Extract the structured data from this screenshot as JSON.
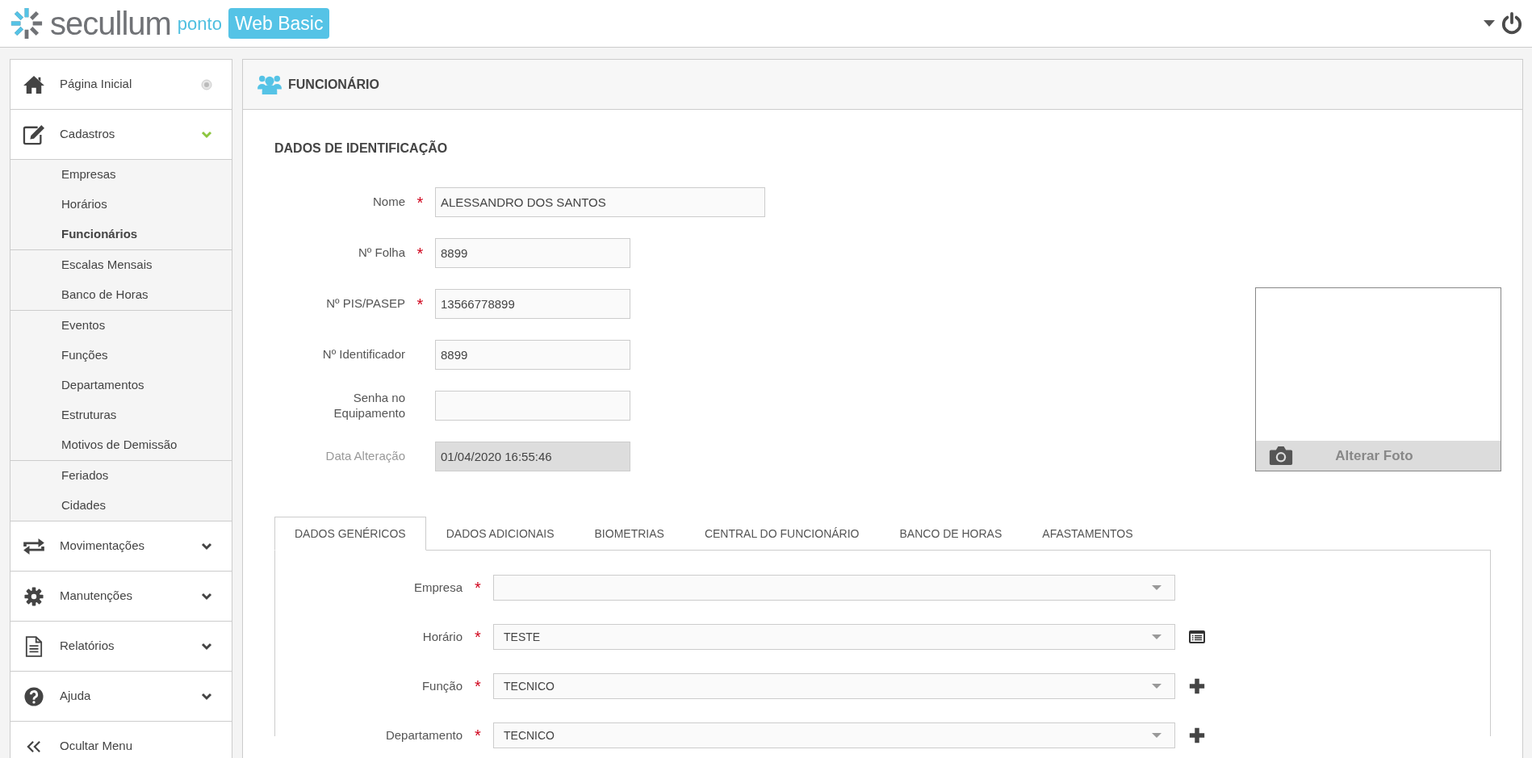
{
  "header": {
    "brand": "secullum",
    "product": "ponto",
    "edition": "Web Basic"
  },
  "sidebar": {
    "items": [
      {
        "kind": "link",
        "label": "Página Inicial"
      },
      {
        "kind": "group",
        "label": "Cadastros",
        "expanded": true,
        "groups": [
          {
            "items": [
              {
                "label": "Empresas",
                "selected": false
              },
              {
                "label": "Horários",
                "selected": false
              },
              {
                "label": "Funcionários",
                "selected": true
              }
            ]
          },
          {
            "items": [
              {
                "label": "Escalas Mensais",
                "selected": false
              },
              {
                "label": "Banco de Horas",
                "selected": false
              }
            ]
          },
          {
            "items": [
              {
                "label": "Eventos",
                "selected": false
              },
              {
                "label": "Funções",
                "selected": false
              },
              {
                "label": "Departamentos",
                "selected": false
              },
              {
                "label": "Estruturas",
                "selected": false
              },
              {
                "label": "Motivos de Demissão",
                "selected": false
              }
            ]
          },
          {
            "items": [
              {
                "label": "Feriados",
                "selected": false
              },
              {
                "label": "Cidades",
                "selected": false
              }
            ]
          }
        ]
      },
      {
        "kind": "group",
        "label": "Movimentações",
        "expanded": false
      },
      {
        "kind": "group",
        "label": "Manutenções",
        "expanded": false
      },
      {
        "kind": "group",
        "label": "Relatórios",
        "expanded": false
      },
      {
        "kind": "group",
        "label": "Ajuda",
        "expanded": false
      },
      {
        "kind": "toggle",
        "label": "Ocultar Menu"
      }
    ]
  },
  "page": {
    "title": "FUNCIONÁRIO"
  },
  "section": {
    "title": "DADOS DE IDENTIFICAÇÃO"
  },
  "fields": [
    {
      "label": "Nome",
      "required_mark": "*",
      "value": "ALESSANDRO DOS SANTOS",
      "disabled": false
    },
    {
      "label": "Nº Folha",
      "required_mark": "*",
      "value": "8899",
      "disabled": false
    },
    {
      "label": "Nº PIS/PASEP",
      "required_mark": "*",
      "value": "13566778899",
      "disabled": false
    },
    {
      "label": "Nº Identificador",
      "value": "8899",
      "disabled": false
    },
    {
      "label": "Senha no Equipamento",
      "disabled": false
    },
    {
      "label": "Data Alteração",
      "value": "01/04/2020 16:55:46",
      "disabled": true
    }
  ],
  "photo": {
    "button": "Alterar Foto"
  },
  "tabs": [
    {
      "label": "DADOS GENÉRICOS",
      "selected": true
    },
    {
      "label": "DADOS ADICIONAIS",
      "selected": false
    },
    {
      "label": "BIOMETRIAS",
      "selected": false
    },
    {
      "label": "CENTRAL DO FUNCIONÁRIO",
      "selected": false
    },
    {
      "label": "BANCO DE HORAS",
      "selected": false
    },
    {
      "label": "AFASTAMENTOS",
      "selected": false
    }
  ],
  "selects": [
    {
      "kind": "plain",
      "label": "Empresa",
      "required_mark": "*"
    },
    {
      "kind": "list",
      "label": "Horário",
      "required_mark": "*",
      "value": "TESTE"
    },
    {
      "kind": "add",
      "label": "Função",
      "required_mark": "*",
      "value": "TECNICO"
    },
    {
      "kind": "add",
      "label": "Departamento",
      "required_mark": "*",
      "value": "TECNICO"
    }
  ]
}
